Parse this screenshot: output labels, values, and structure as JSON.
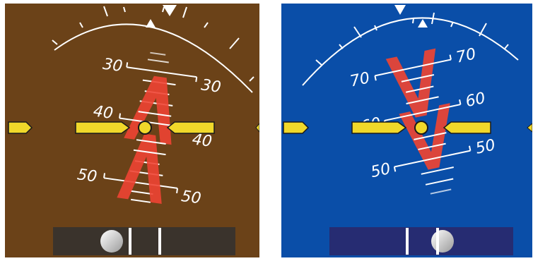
{
  "colors": {
    "ground": "#6b4218",
    "sky": "#0a4ea8",
    "chevron": "#ee4433",
    "symbol_yellow": "#f0d82a",
    "symbol_outline": "#1a1a1a",
    "slip_bar_left": "#3a332c",
    "slip_bar_right": "#262c72",
    "markings": "#ffffff"
  },
  "panels": {
    "nose_high": {
      "description_attitude": "nose-down ground view",
      "chevron_direction": "up",
      "pitch_labels": [
        "30",
        "30",
        "40",
        "40",
        "50",
        "50"
      ],
      "slip_indicator": "ball",
      "icons": [
        "roll-pointer-icon",
        "aircraft-symbol-icon",
        "slip-ball-icon"
      ]
    },
    "nose_low": {
      "chevron_direction": "down",
      "pitch_labels": [
        "70",
        "70",
        "60",
        "60",
        "50",
        "50"
      ],
      "slip_indicator": "ball",
      "icons": [
        "roll-pointer-icon",
        "aircraft-symbol-icon",
        "slip-ball-icon"
      ]
    }
  }
}
